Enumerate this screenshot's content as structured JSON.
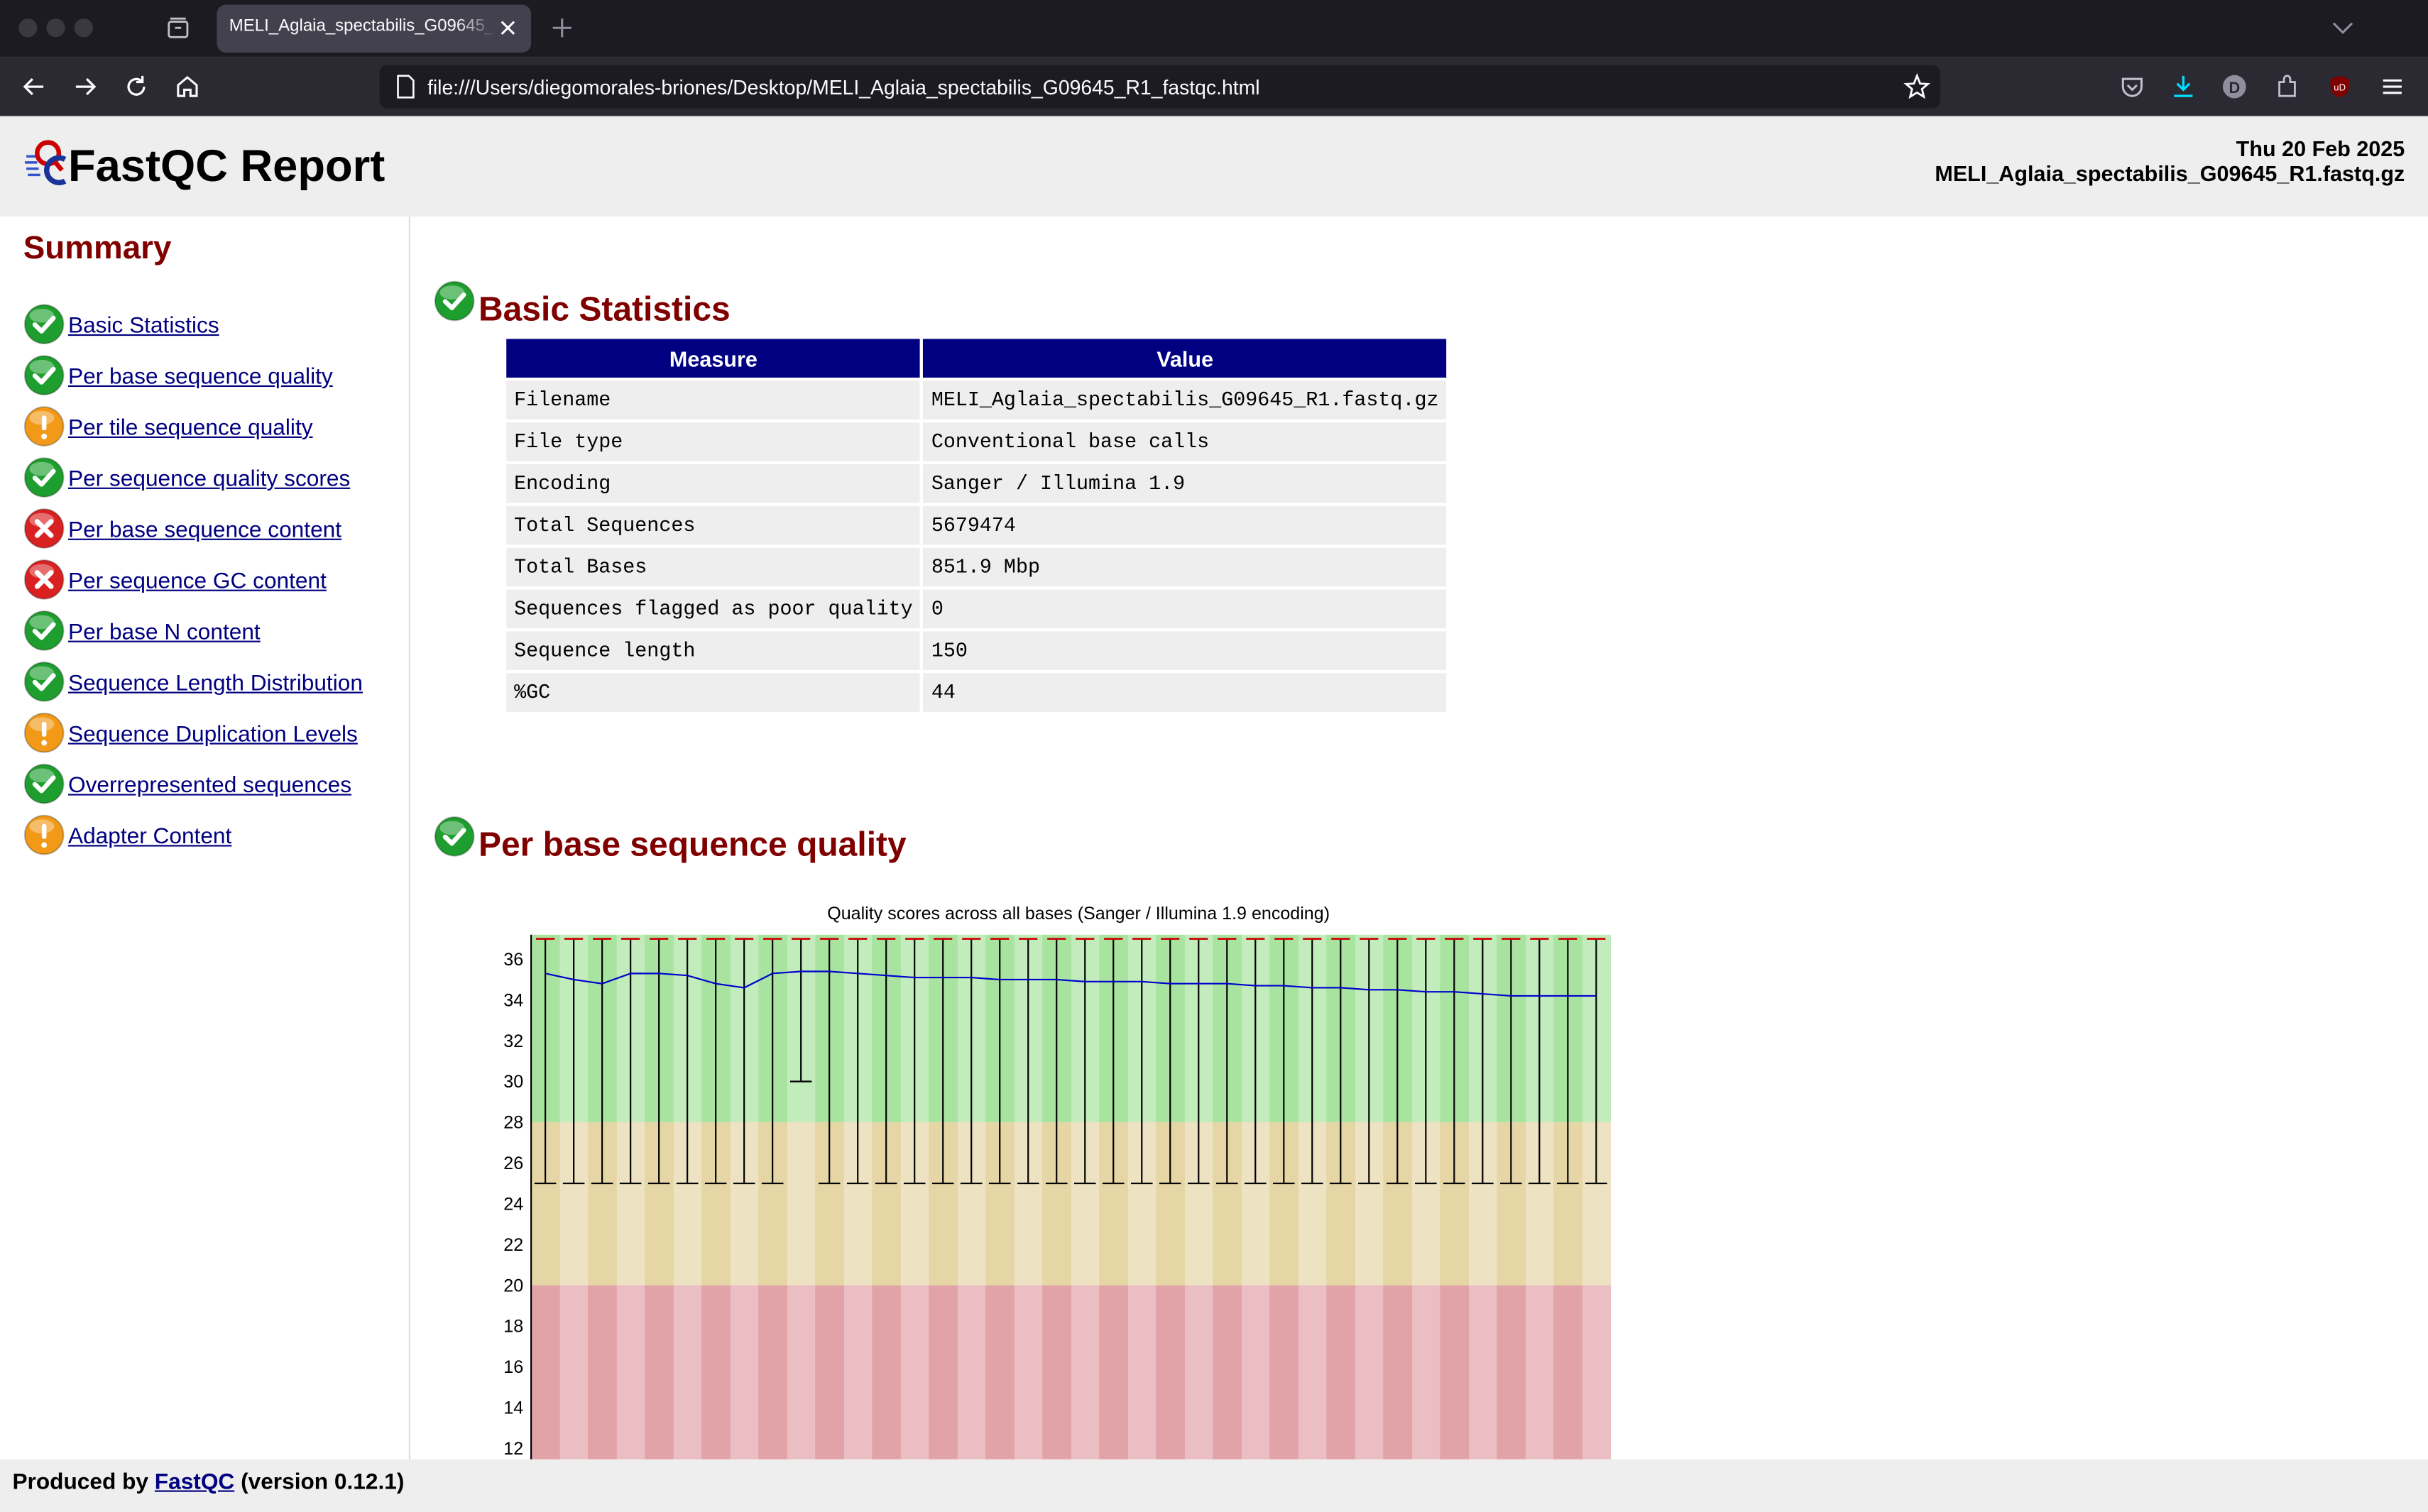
{
  "browser": {
    "tab_title": "MELI_Aglaia_spectabilis_G09645_R1_fastqc.html",
    "url": "file:///Users/diegomorales-briones/Desktop/MELI_Aglaia_spectabilis_G09645_R1_fastqc.html",
    "profile_initial": "D",
    "extension_badge": "uD"
  },
  "header": {
    "title": "FastQC Report",
    "date": "Thu 20 Feb 2025",
    "filename": "MELI_Aglaia_spectabilis_G09645_R1.fastq.gz"
  },
  "summary": {
    "title": "Summary",
    "items": [
      {
        "label": "Basic Statistics",
        "status": "pass"
      },
      {
        "label": "Per base sequence quality",
        "status": "pass"
      },
      {
        "label": "Per tile sequence quality",
        "status": "warn"
      },
      {
        "label": "Per sequence quality scores",
        "status": "pass"
      },
      {
        "label": "Per base sequence content",
        "status": "fail"
      },
      {
        "label": "Per sequence GC content",
        "status": "fail"
      },
      {
        "label": "Per base N content",
        "status": "pass"
      },
      {
        "label": "Sequence Length Distribution",
        "status": "pass"
      },
      {
        "label": "Sequence Duplication Levels",
        "status": "warn"
      },
      {
        "label": "Overrepresented sequences",
        "status": "pass"
      },
      {
        "label": "Adapter Content",
        "status": "warn"
      }
    ]
  },
  "basic_statistics": {
    "title": "Basic Statistics",
    "status": "pass",
    "columns": [
      "Measure",
      "Value"
    ],
    "rows": [
      [
        "Filename",
        "MELI_Aglaia_spectabilis_G09645_R1.fastq.gz"
      ],
      [
        "File type",
        "Conventional base calls"
      ],
      [
        "Encoding",
        "Sanger / Illumina 1.9"
      ],
      [
        "Total Sequences",
        "5679474"
      ],
      [
        "Total Bases",
        "851.9 Mbp"
      ],
      [
        "Sequences flagged as poor quality",
        "0"
      ],
      [
        "Sequence length",
        "150"
      ],
      [
        "%GC",
        "44"
      ]
    ]
  },
  "per_base_quality": {
    "title": "Per base sequence quality",
    "status": "pass"
  },
  "chart_data": {
    "type": "box",
    "title": "Quality scores across all bases (Sanger / Illumina 1.9 encoding)",
    "ylim": [
      11,
      37.2
    ],
    "yticks": [
      12,
      14,
      16,
      18,
      20,
      22,
      24,
      26,
      28,
      30,
      32,
      34,
      36
    ],
    "zones": {
      "good": [
        28,
        37.2
      ],
      "ok": [
        20,
        28
      ],
      "poor": [
        11,
        20
      ]
    },
    "colors": {
      "good": "#a8e4a0",
      "ok": "#e6d6a6",
      "poor": "#e1a3a8",
      "mean": "#0000cc",
      "median": "#cc0000"
    },
    "n_bins": 38,
    "mean": [
      35.3,
      35.0,
      34.8,
      35.3,
      35.3,
      35.2,
      34.8,
      34.6,
      35.3,
      35.4,
      35.4,
      35.3,
      35.2,
      35.1,
      35.1,
      35.1,
      35.0,
      35.0,
      35.0,
      34.9,
      34.9,
      34.9,
      34.8,
      34.8,
      34.8,
      34.7,
      34.7,
      34.6,
      34.6,
      34.5,
      34.5,
      34.4,
      34.4,
      34.3,
      34.2,
      34.2,
      34.2,
      34.2
    ],
    "median": [
      37,
      37,
      37,
      37,
      37,
      37,
      37,
      37,
      37,
      37,
      37,
      37,
      37,
      37,
      37,
      37,
      37,
      37,
      37,
      37,
      37,
      37,
      37,
      37,
      37,
      37,
      37,
      37,
      37,
      37,
      37,
      37,
      37,
      37,
      37,
      37,
      37,
      37
    ],
    "whisker_low": [
      25,
      25,
      25,
      25,
      25,
      25,
      25,
      25,
      25,
      30,
      25,
      25,
      25,
      25,
      25,
      25,
      25,
      25,
      25,
      25,
      25,
      25,
      25,
      25,
      25,
      25,
      25,
      25,
      25,
      25,
      25,
      25,
      25,
      25,
      25,
      25,
      25,
      25
    ],
    "whisker_high": [
      37,
      37,
      37,
      37,
      37,
      37,
      37,
      37,
      37,
      37,
      37,
      37,
      37,
      37,
      37,
      37,
      37,
      37,
      37,
      37,
      37,
      37,
      37,
      37,
      37,
      37,
      37,
      37,
      37,
      37,
      37,
      37,
      37,
      37,
      37,
      37,
      37,
      37
    ]
  },
  "footer": {
    "prefix": "Produced by ",
    "link": "FastQC",
    "suffix": " (version 0.12.1)"
  }
}
